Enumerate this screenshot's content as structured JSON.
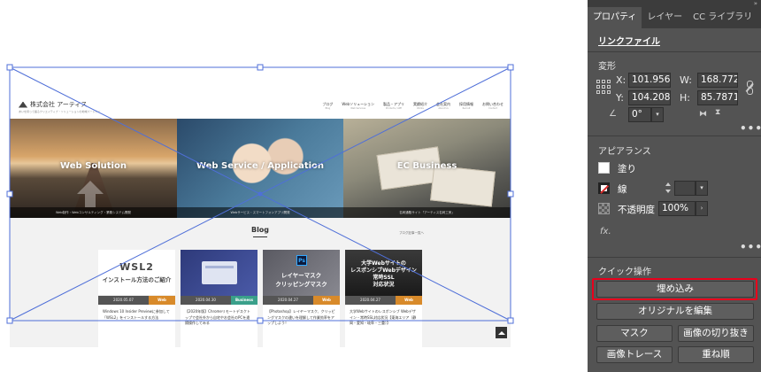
{
  "site": {
    "logo_text": "株式会社 アーティス",
    "tagline": "あいを持って語るクリエイティブ・ソリューションの地域パートナー",
    "nav": [
      {
        "label": "ブログ",
        "sub": "Blog"
      },
      {
        "label": "Webソリューション",
        "sub": "Web Services"
      },
      {
        "label": "製品・アプリ",
        "sub": "Products / APP"
      },
      {
        "label": "実績紹介",
        "sub": "Works"
      },
      {
        "label": "会社案内",
        "sub": "About Us"
      },
      {
        "label": "採用情報",
        "sub": "Recruit"
      },
      {
        "label": "お問い合わせ",
        "sub": "Contact"
      }
    ],
    "hero": [
      {
        "title": "Web Solution",
        "caption": "Web制作・Webコンサルティング・業務システム開発"
      },
      {
        "title": "Web Service / Application",
        "caption": "Webサービス・スマートフォンアプリ開発"
      },
      {
        "title": "EC Business",
        "caption": "名刺通販サイト「アーティス名刺工房」"
      }
    ],
    "blog": {
      "title": "Blog",
      "more": "ブログ記事一覧へ",
      "posts": [
        {
          "thumb_big": "WSL2",
          "thumb_small": "インストール方法のご紹介",
          "date": "2020.05.07",
          "category": "Web",
          "cat_color": "#d88a2a",
          "text": "Windows 10 Insider Previewに参加して「WSL2」をインストールする方法"
        },
        {
          "date": "2020.04.30",
          "category": "Business",
          "cat_color": "#3aa08a",
          "text": "【2020年版】Chromeリモートデスクトップで会社外から自宅やお会社のPCを遠隔操作してみる"
        },
        {
          "thumb_ps": "Ps",
          "thumb_l1": "レイヤーマスク",
          "thumb_l2": "クリッピングマスク",
          "date": "2020.04.27",
          "category": "Web",
          "cat_color": "#d88a2a",
          "text": "【Photoshop】レイヤーマスク、クリッピングマスクの違いを理解して作業効率をアップしよう！"
        },
        {
          "thumb_lines": [
            "大学Webサイトの",
            "レスポンシブWebデザイン",
            "常時SSL",
            "対応状況"
          ],
          "date": "2020.04.27",
          "category": "Web",
          "cat_color": "#d88a2a",
          "text": "大学Webサイトのレスポンシブ Webデザイン・常時SSL対応状況【東海エリア（静岡・愛知・岐阜・三重）】"
        }
      ]
    }
  },
  "panel": {
    "tabs": [
      {
        "label": "プロパティ",
        "active": true
      },
      {
        "label": "レイヤー",
        "active": false
      },
      {
        "label": "CC ライブラリ",
        "active": false
      }
    ],
    "link_file": "リンクファイル",
    "transform": {
      "title": "変形",
      "x_label": "X:",
      "x_value": "101.956",
      "y_label": "Y:",
      "y_value": "104.208",
      "w_label": "W:",
      "w_value": "168.772",
      "h_label": "H:",
      "h_value": "85.7871",
      "angle_value": "0°"
    },
    "appearance": {
      "title": "アピアランス",
      "fill_label": "塗り",
      "stroke_label": "線",
      "opacity_label": "不透明度",
      "opacity_value": "100%",
      "fx_label": "fx."
    },
    "quick_actions": {
      "title": "クイック操作",
      "embed": "埋め込み",
      "edit_original": "オリジナルを編集",
      "mask": "マスク",
      "crop_image": "画像の切り抜き",
      "image_trace": "画像トレース",
      "arrange": "重ね順"
    },
    "more_dots": "•••",
    "collapse": "»",
    "highlight_color": "#e8001c"
  }
}
